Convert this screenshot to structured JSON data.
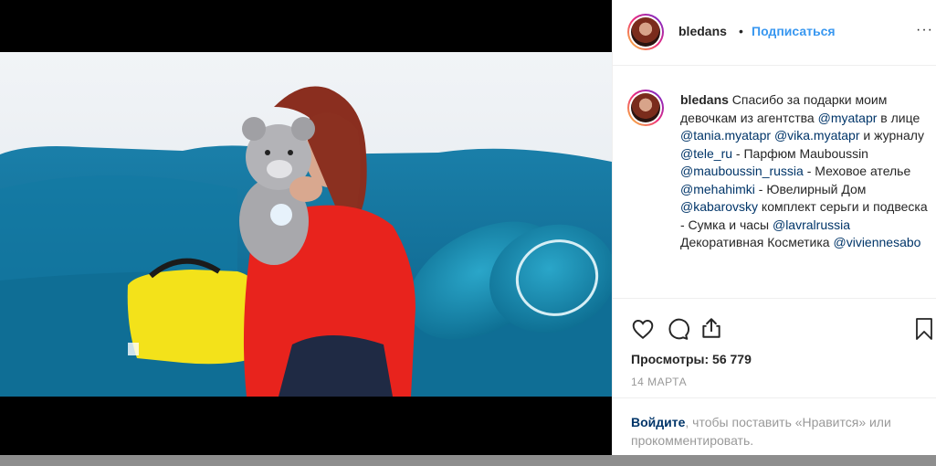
{
  "post": {
    "username": "bledans",
    "separator": "•",
    "follow_label": "Подписаться",
    "more_label": "···",
    "caption": [
      {
        "t": "Спасибо за подарки моим девочкам из агентства ",
        "k": "text"
      },
      {
        "t": "@myatapr",
        "k": "mention"
      },
      {
        "t": " в лице ",
        "k": "text"
      },
      {
        "t": "@tania.myatapr",
        "k": "mention"
      },
      {
        "t": " ",
        "k": "text"
      },
      {
        "t": "@vika.myatapr",
        "k": "mention"
      },
      {
        "t": " и журналу ",
        "k": "text"
      },
      {
        "t": "@tele_ru",
        "k": "mention"
      },
      {
        "t": " - Парфюм Mauboussin ",
        "k": "text"
      },
      {
        "t": "@mauboussin_russia",
        "k": "mention"
      },
      {
        "t": " - Меховое ателье ",
        "k": "text"
      },
      {
        "t": "@mehahimki",
        "k": "mention"
      },
      {
        "t": " - Ювелирный Дом ",
        "k": "text"
      },
      {
        "t": "@kabarovsky",
        "k": "mention"
      },
      {
        "t": " комплект серьги и подвеска - Сумка и часы ",
        "k": "text"
      },
      {
        "t": "@lavralrussia",
        "k": "mention"
      },
      {
        "t": " Декоративная Косметика ",
        "k": "text"
      },
      {
        "t": "@viviennesabo",
        "k": "mention"
      }
    ],
    "views": "Просмотры: 56 779",
    "date": "14 МАРТА",
    "login_link": "Войдите",
    "login_text": ", чтобы поставить «Нравится» или прокомментировать."
  },
  "icons": {
    "like": "heart-icon",
    "comment": "comment-icon",
    "share": "share-icon",
    "save": "bookmark-icon",
    "more": "more-icon"
  },
  "colors": {
    "link": "#3897f0",
    "mention": "#003569",
    "text": "#262626",
    "muted": "#999999"
  }
}
